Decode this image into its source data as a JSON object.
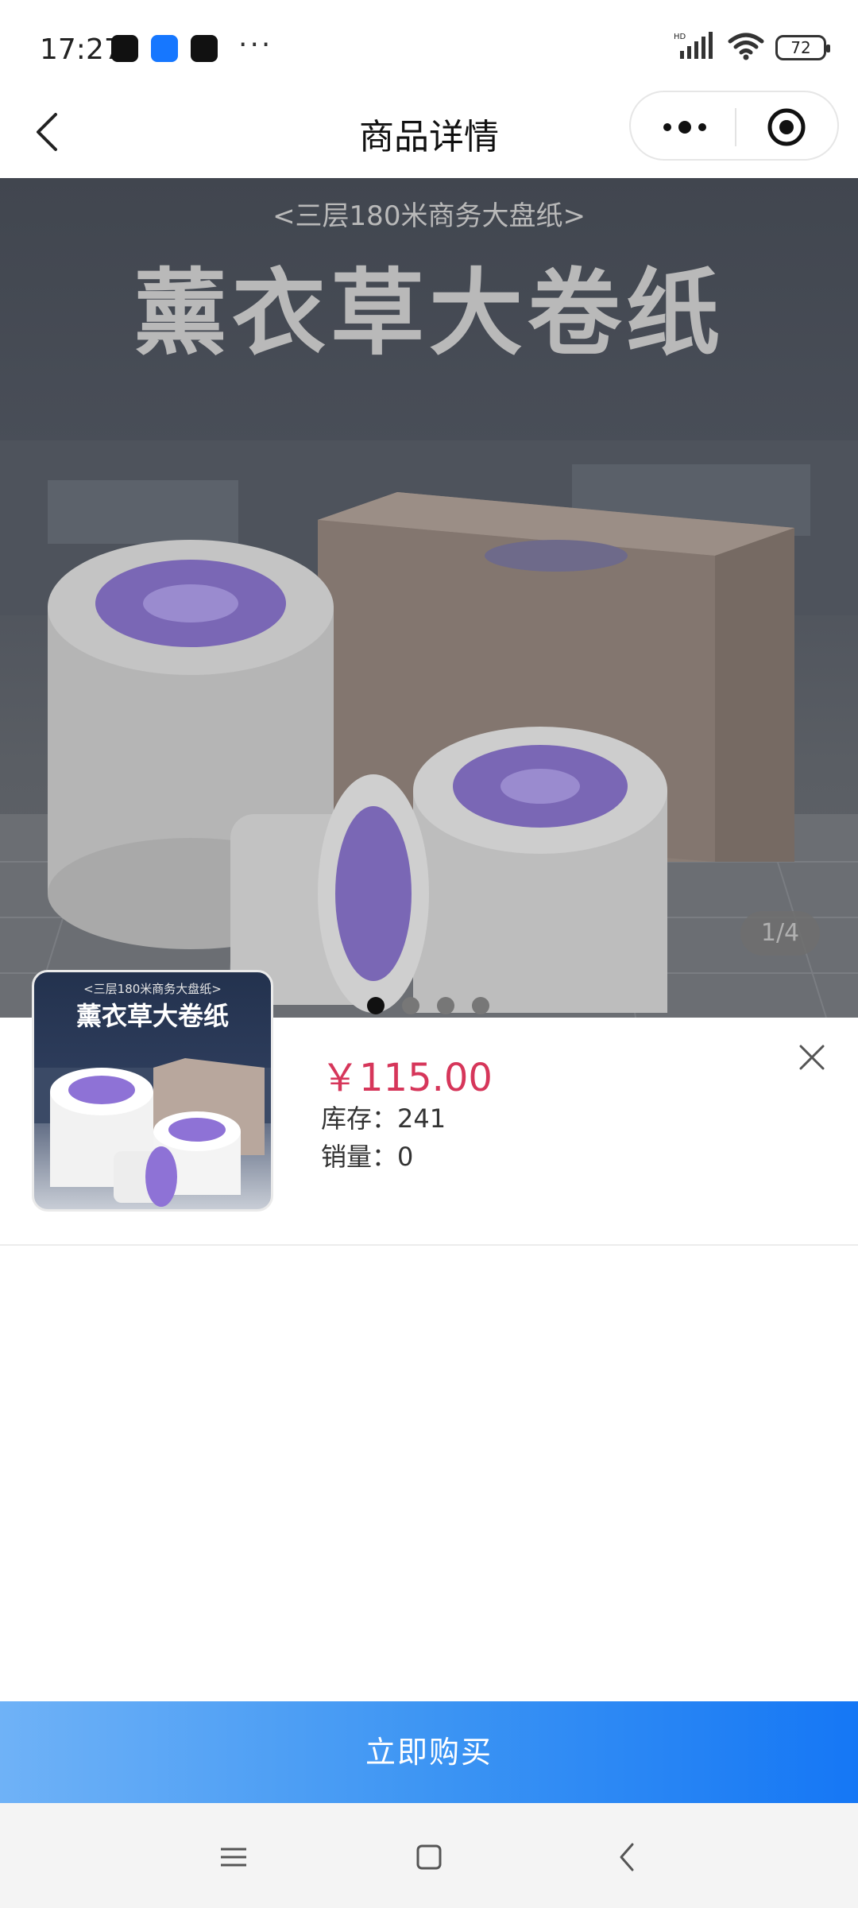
{
  "status_bar": {
    "time": "17:27",
    "more": "···",
    "network": "HD",
    "battery": "72",
    "apps": [
      "douyin-lite-icon",
      "alipay-icon",
      "douyin-icon"
    ]
  },
  "nav": {
    "title": "商品详情",
    "back_icon": "back-chevron-icon",
    "more_icon": "more-dots-icon",
    "close_icon": "target-circle-icon"
  },
  "gallery": {
    "image_subtitle": "<三层180米商务大盘纸>",
    "image_title": "薰衣草大卷纸",
    "counter": "1/4",
    "total": 4,
    "current": 1
  },
  "product": {
    "thumb_subtitle": "<三层180米商务大盘纸>",
    "thumb_title": "薰衣草大卷纸",
    "price": "￥115.00",
    "stock": "库存：241",
    "sales": "销量：0"
  },
  "actions": {
    "buy_label": "立即购买"
  },
  "colors": {
    "price": "#d6365a",
    "buy_gradient_start": "#6fb2f7",
    "buy_gradient_end": "#1577f5"
  }
}
